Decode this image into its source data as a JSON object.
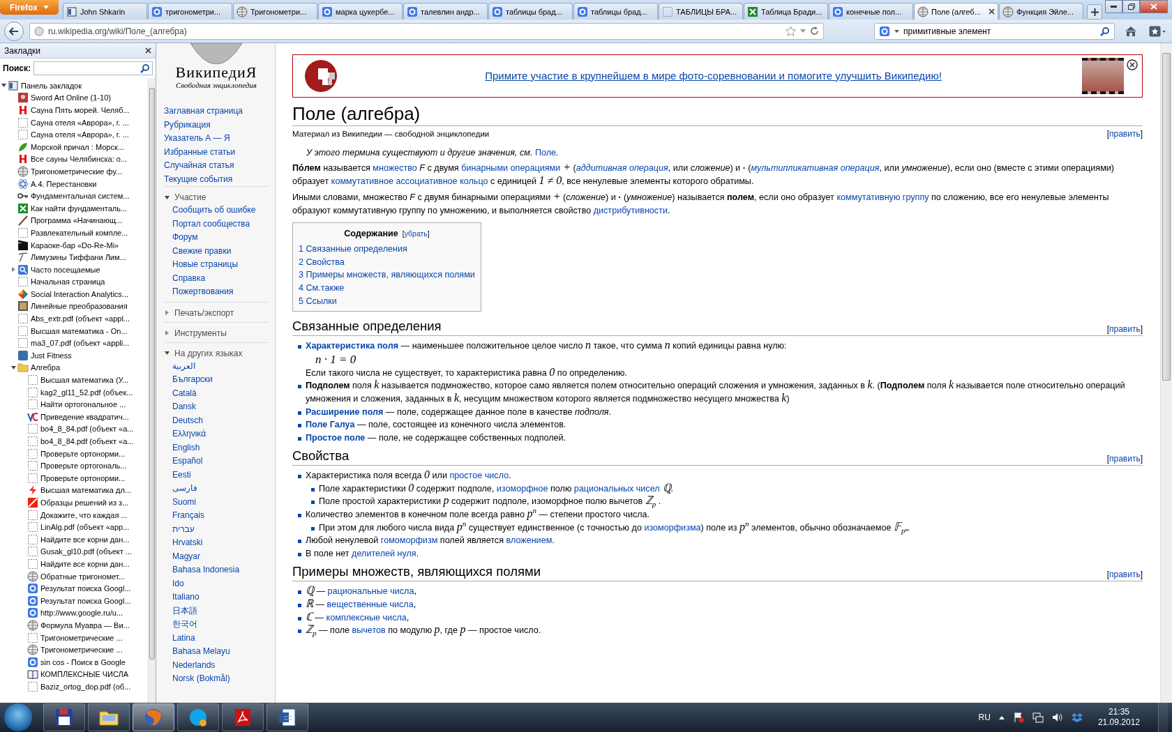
{
  "browser": {
    "menu_button": "Firefox",
    "tabs": [
      {
        "title": "John Shkarin",
        "selected": false
      },
      {
        "title": "тригонометри...",
        "selected": false
      },
      {
        "title": "Тригонометри...",
        "selected": false
      },
      {
        "title": "марка цукербе...",
        "selected": false
      },
      {
        "title": "талевлин андр...",
        "selected": false
      },
      {
        "title": "таблицы брад...",
        "selected": false
      },
      {
        "title": "таблицы брад...",
        "selected": false
      },
      {
        "title": "ТАБЛИЦЫ БРА...",
        "selected": false
      },
      {
        "title": "Таблица Бради...",
        "selected": false
      },
      {
        "title": "конечные пол...",
        "selected": false
      },
      {
        "title": "Поле (алгеб...",
        "selected": true
      },
      {
        "title": "Функция Эйле...",
        "selected": false
      }
    ],
    "url": "ru.wikipedia.org/wiki/Поле_(алгебра)",
    "search_value": "примитивные элемент"
  },
  "sidebar": {
    "title": "Закладки",
    "search_label": "Поиск:",
    "bookmarks": [
      {
        "title": "Панель закладок",
        "expanded": true,
        "children": [
          {
            "title": "Sword Art Online (1-10)"
          },
          {
            "title": "Сауна Пять морей. Челяб..."
          },
          {
            "title": "Сауна отеля «Аврора», г. ..."
          },
          {
            "title": "Сауна отеля «Аврора», г. ..."
          },
          {
            "title": "Морской причал : Морск..."
          },
          {
            "title": "Все сауны Челябинска: о..."
          },
          {
            "title": "Тригонометрические фу..."
          },
          {
            "title": "A.4. Перестановки"
          },
          {
            "title": "Фундаментальная систем..."
          },
          {
            "title": "Как найти фундаменталь..."
          },
          {
            "title": "Программа «Начинающ..."
          },
          {
            "title": "Развлекательный компле..."
          },
          {
            "title": "Караоке-бар «Do-Re-Mi»"
          },
          {
            "title": "Лимузины Тиффани Лим..."
          },
          {
            "title": "Часто посещаемые",
            "expanded": false
          },
          {
            "title": "Начальная страница"
          },
          {
            "title": "Social Interaction Analytics..."
          },
          {
            "title": "Линейные преобразования"
          },
          {
            "title": "Abs_extr.pdf (объект «appl..."
          },
          {
            "title": "Высшая математика - On..."
          },
          {
            "title": "ma3_07.pdf (объект «appli..."
          },
          {
            "title": "Just Fitness"
          },
          {
            "title": "Алгебра",
            "expanded": true,
            "children": [
              {
                "title": "Высшая математика (У..."
              },
              {
                "title": "kag2_gl11_52.pdf (объек..."
              },
              {
                "title": "Найти ортогональное ..."
              },
              {
                "title": "Приведение квадратич..."
              },
              {
                "title": "bo4_8_84.pdf (объект «а..."
              },
              {
                "title": "bo4_8_84.pdf (объект «а..."
              },
              {
                "title": "Проверьте ортонорми..."
              },
              {
                "title": "Проверьте ортогональ..."
              },
              {
                "title": "Проверьте ортонорми..."
              },
              {
                "title": "Высшая математика дл..."
              },
              {
                "title": "Образцы решений из з..."
              },
              {
                "title": "Докажите, что каждая ..."
              },
              {
                "title": "LinAlg.pdf (объект «app..."
              },
              {
                "title": "Найдите все корни дан..."
              },
              {
                "title": "Gusak_gl10.pdf (объект ..."
              },
              {
                "title": "Найдите все корни дан..."
              },
              {
                "title": "Обратные тригономет..."
              },
              {
                "title": "Результат поиска Googl..."
              },
              {
                "title": "Результат поиска Googl..."
              },
              {
                "title": "http://www.google.ru/u..."
              },
              {
                "title": "Формула Муавра — Ви..."
              },
              {
                "title": "Тригонометрические ..."
              },
              {
                "title": "Тригонометрические ..."
              },
              {
                "title": "sin cos - Поиск в Google"
              },
              {
                "title": "КОМПЛЕКСНЫЕ ЧИСЛА"
              },
              {
                "title": "Baziz_ortog_dop.pdf (об..."
              }
            ]
          }
        ]
      }
    ]
  },
  "wiki_nav": {
    "logo_title": "ВикипедиЯ",
    "logo_subtitle": "Свободная энциклопедия",
    "links": [
      "Заглавная страница",
      "Рубрикация",
      "Указатель А — Я",
      "Избранные статьи",
      "Случайная статья",
      "Текущие события"
    ],
    "portals": [
      {
        "title": "Участие",
        "expanded": true,
        "links": [
          "Сообщить об ошибке",
          "Портал сообщества",
          "Форум",
          "Свежие правки",
          "Новые страницы",
          "Справка",
          "Пожертвования"
        ]
      },
      {
        "title": "Печать/экспорт",
        "expanded": false
      },
      {
        "title": "Инструменты",
        "expanded": false
      },
      {
        "title": "На других языках",
        "expanded": true,
        "links": [
          "العربية",
          "Български",
          "Català",
          "Dansk",
          "Deutsch",
          "Ελληνικά",
          "English",
          "Español",
          "Eesti",
          "فارسی",
          "Suomi",
          "Français",
          "עברית",
          "Hrvatski",
          "Magyar",
          "Bahasa Indonesia",
          "Ido",
          "Italiano",
          "日本語",
          "한국어",
          "Latina",
          "Bahasa Melayu",
          "Nederlands",
          "Norsk (Bokmål)"
        ]
      }
    ]
  },
  "article": {
    "banner": "Примите участие в крупнейшем в мире фото-соревновании и помогите улучшить Википедию!",
    "title": "Поле (алгебра)",
    "subtitle": "Материал из Википедии — свободной энциклопедии",
    "edit": [
      "[",
      "править",
      "]"
    ],
    "hatnote": [
      "У этого термина существуют и другие значения, см. ",
      {
        "kind": "link",
        "text": "Поле"
      },
      "."
    ],
    "paragraphs": [
      [
        {
          "kind": "bold",
          "text": "По́лем"
        },
        " называется ",
        {
          "kind": "link",
          "text": "множество"
        },
        " *F* с двумя ",
        {
          "kind": "link",
          "text": "бинарными операциями"
        },
        {
          "kind": "math",
          "text": " +"
        },
        " (",
        {
          "kind": "ilink",
          "text": "аддитивная операция"
        },
        ", или *сложение*) и **·** (",
        {
          "kind": "ilink",
          "text": "мультипликативная операция"
        },
        ", или *умножение*), если оно (вместе с этими операциями) образует ",
        {
          "kind": "link",
          "text": "коммутативное ассоциативное кольцо"
        },
        " с единицей ",
        {
          "kind": "math",
          "text": "1 ≠ 0"
        },
        ", все ненулевые элементы которого обратимы."
      ],
      [
        "Иными словами, множество *F* с двумя бинарными операциями ",
        {
          "kind": "math",
          "text": "+"
        },
        " (*сложение*) и **·** (*умножение*) называется **полем**, если оно образует ",
        {
          "kind": "link",
          "text": "коммутативную группу"
        },
        " по сложению, все его ненулевые элементы образуют коммутативную группу по умножению, и выполняется свойство ",
        {
          "kind": "link",
          "text": "дистрибутивности"
        },
        "."
      ]
    ],
    "toc": {
      "title": "Содержание",
      "toggle": [
        "[",
        "убрать",
        "]"
      ],
      "items": [
        "1 Связанные определения",
        "2 Свойства",
        "3 Примеры множеств, являющихся полями",
        "4 См.также",
        "5 Ссылки"
      ]
    },
    "sections": [
      {
        "heading": "Связанные определения",
        "edit": [
          "[",
          "править",
          "]"
        ],
        "items": [
          {
            "blocks": [
              [
                {
                  "kind": "boldlink",
                  "text": "Характеристика поля"
                },
                " — наименьшее положительное целое число ",
                {
                  "kind": "math",
                  "text": "n"
                },
                " такое, что сумма ",
                {
                  "kind": "math",
                  "text": "n"
                },
                " копий единицы равна нулю:"
              ],
              [
                {
                  "kind": "display",
                  "text": "n · 1 = 0"
                }
              ],
              [
                "Если такого числа не существует, то характеристика равна ",
                {
                  "kind": "math",
                  "text": "0"
                },
                " по определению."
              ]
            ]
          },
          {
            "blocks": [
              [
                "**Подполем** поля ",
                {
                  "kind": "math",
                  "text": "k"
                },
                " называется подмножество, которое само является полем относительно операций сложения и умножения, заданных в ",
                {
                  "kind": "math",
                  "text": "k"
                },
                ". (**Подполем** поля ",
                {
                  "kind": "math",
                  "text": "k"
                },
                " называется поле относительно операций умножения и сложения, заданных в ",
                {
                  "kind": "math",
                  "text": "k"
                },
                ", несущим множеством которого является подмножество несущего множества ",
                {
                  "kind": "math",
                  "text": "k"
                },
                ")"
              ]
            ]
          },
          {
            "blocks": [
              [
                {
                  "kind": "boldlink",
                  "text": "Расширение поля"
                },
                " — поле, содержащее данное поле в качестве *подполя*."
              ]
            ]
          },
          {
            "blocks": [
              [
                {
                  "kind": "boldlink",
                  "text": "Поле Галуа"
                },
                " — поле, состоящее из конечного числа элементов."
              ]
            ]
          },
          {
            "blocks": [
              [
                {
                  "kind": "boldlink",
                  "text": "Простое поле"
                },
                " — поле, не содержащее собственных подполей."
              ]
            ]
          }
        ]
      },
      {
        "heading": "Свойства",
        "edit": [
          "[",
          "править",
          "]"
        ],
        "items": [
          {
            "blocks": [
              [
                "Характеристика поля всегда ",
                {
                  "kind": "math",
                  "text": "0"
                },
                " или ",
                {
                  "kind": "link",
                  "text": "простое число"
                },
                "."
              ]
            ],
            "children": [
              {
                "blocks": [
                  [
                    "Поле характеристики ",
                    {
                      "kind": "math",
                      "text": "0"
                    },
                    " содержит подполе, ",
                    {
                      "kind": "link",
                      "text": "изоморфное"
                    },
                    " полю ",
                    {
                      "kind": "link",
                      "text": "рациональных чисел"
                    },
                    {
                      "kind": "math",
                      "text": " ℚ"
                    },
                    "."
                  ]
                ]
              },
              {
                "blocks": [
                  [
                    "Поле простой характеристики ",
                    {
                      "kind": "math",
                      "text": "p"
                    },
                    " содержит подполе, изоморфное полю вычетов ",
                    {
                      "kind": "math",
                      "text": "ℤ$_{p}$"
                    },
                    " ."
                  ]
                ]
              }
            ]
          },
          {
            "blocks": [
              [
                "Количество элементов в конечном поле всегда равно ",
                {
                  "kind": "math",
                  "text": "p$^{n}$"
                },
                " — степени простого числа."
              ]
            ],
            "children": [
              {
                "blocks": [
                  [
                    "При этом для любого числа вида ",
                    {
                      "kind": "math",
                      "text": "p$^{n}$"
                    },
                    " существует единственное (с точностью до ",
                    {
                      "kind": "link",
                      "text": "изоморфизма"
                    },
                    ") поле из ",
                    {
                      "kind": "math",
                      "text": "p$^{n}$"
                    },
                    " элементов, обычно обозначаемое ",
                    {
                      "kind": "math",
                      "text": "𝔽$_{pⁿ}$"
                    },
                    "."
                  ]
                ]
              }
            ]
          },
          {
            "blocks": [
              [
                "Любой ненулевой ",
                {
                  "kind": "link",
                  "text": "гомоморфизм"
                },
                " полей является ",
                {
                  "kind": "link",
                  "text": "вложением"
                },
                "."
              ]
            ]
          },
          {
            "blocks": [
              [
                "В поле нет ",
                {
                  "kind": "link",
                  "text": "делителей нуля"
                },
                "."
              ]
            ]
          }
        ]
      },
      {
        "heading": "Примеры множеств, являющихся полями",
        "edit": [
          "[",
          "править",
          "]"
        ],
        "items": [
          {
            "blocks": [
              [
                {
                  "kind": "math",
                  "text": "ℚ"
                },
                " — ",
                {
                  "kind": "link",
                  "text": "рациональные числа"
                },
                ","
              ]
            ]
          },
          {
            "blocks": [
              [
                {
                  "kind": "math",
                  "text": "ℝ"
                },
                " — ",
                {
                  "kind": "link",
                  "text": "вещественные числа"
                },
                ","
              ]
            ]
          },
          {
            "blocks": [
              [
                {
                  "kind": "math",
                  "text": "ℂ"
                },
                " — ",
                {
                  "kind": "link",
                  "text": "комплексные числа"
                },
                ","
              ]
            ]
          },
          {
            "blocks": [
              [
                {
                  "kind": "math",
                  "text": "ℤ$_{p}$"
                },
                " — поле ",
                {
                  "kind": "link",
                  "text": "вычетов"
                },
                " по модулю ",
                {
                  "kind": "math",
                  "text": "p"
                },
                ", где ",
                {
                  "kind": "math",
                  "text": "p"
                },
                " — простое число."
              ]
            ]
          }
        ]
      }
    ]
  },
  "taskbar": {
    "apps": [
      {
        "active": false
      },
      {
        "active": false
      },
      {
        "active": true
      },
      {
        "active": false
      },
      {
        "active": false
      },
      {
        "active": false
      }
    ],
    "language": "RU",
    "time": "21:35",
    "date": "21.09.2012"
  }
}
